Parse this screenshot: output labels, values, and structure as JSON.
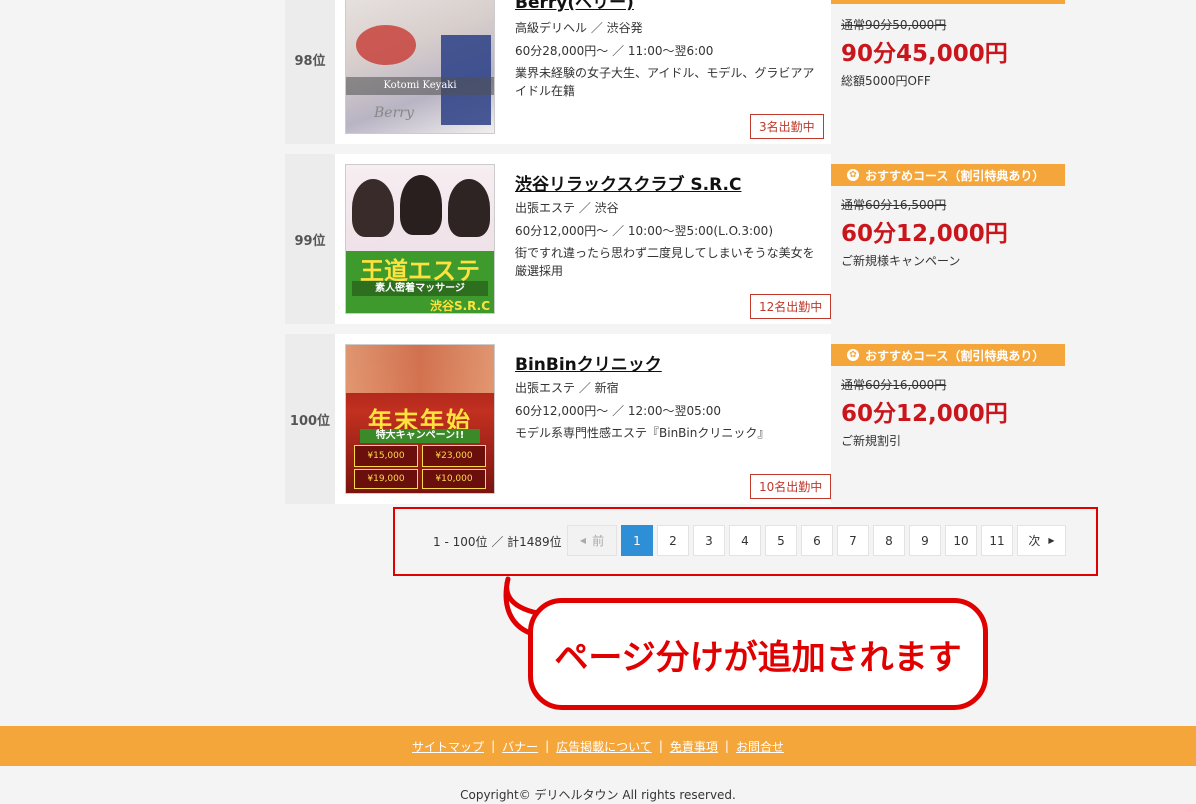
{
  "shops": [
    {
      "rank": "98位",
      "name": "Berry(ベリー)",
      "category": "高級デリヘル ／ 渋谷発",
      "hours": "60分28,000円～ ／ 11:00～翌6:00",
      "desc": "業界未経験の女子大生、アイドル、モデル、グラビアアイドル在籍",
      "staff": "3名出勤中",
      "regular": "通常90分50,000円",
      "price": "90分45,000円",
      "note": "総額5000円OFF",
      "thumb_text": "Kotomi Keyaki",
      "thumb_logo": "Berry"
    },
    {
      "rank": "99位",
      "name": "渋谷リラックスクラブ S.R.C",
      "category": "出張エステ ／ 渋谷",
      "hours": "60分12,000円～ ／ 10:00～翌5:00(L.O.3:00)",
      "desc": "街ですれ違ったら思わず二度見してしまいそうな美女を厳選採用",
      "staff": "12名出勤中",
      "course_head": "おすすめコース（割引特典あり）",
      "regular": "通常60分16,500円",
      "price": "60分12,000円",
      "note": "ご新規様キャンペーン",
      "thumb_title": "王道エステ",
      "thumb_sub": "素人密着マッサージ",
      "thumb_shop": "渋谷S.R.C"
    },
    {
      "rank": "100位",
      "name": "BinBinクリニック",
      "category": "出張エステ ／ 新宿",
      "hours": "60分12,000円～ ／ 12:00～翌05:00",
      "desc": "モデル系専門性感エステ『BinBinクリニック』",
      "staff": "10名出勤中",
      "course_head": "おすすめコース（割引特典あり）",
      "regular": "通常60分16,000円",
      "price": "60分12,000円",
      "note": "ご新規割引",
      "thumb_title": "年末年始",
      "thumb_sub": "特大キャンペーン!!",
      "thumb_p1": "¥15,000",
      "thumb_p2": "¥23,000",
      "thumb_p3": "¥19,000",
      "thumb_p4": "¥10,000"
    }
  ],
  "pager": {
    "count": "1 - 100位 ／ 計1489位",
    "prev": "前",
    "next": "次",
    "pages": [
      "1",
      "2",
      "3",
      "4",
      "5",
      "6",
      "7",
      "8",
      "9",
      "10",
      "11"
    ],
    "current": "1"
  },
  "annotation": "ページ分けが追加されます",
  "footer": {
    "links": [
      "サイトマップ",
      "バナー",
      "広告掲載について",
      "免責事項",
      "お問合せ"
    ],
    "copyright": "Copyright© デリヘルタウン All rights reserved."
  },
  "colors": {
    "accent": "#f4a63a",
    "price": "#c9161c",
    "highlight": "#e00000",
    "active_page": "#2f8fd6"
  }
}
